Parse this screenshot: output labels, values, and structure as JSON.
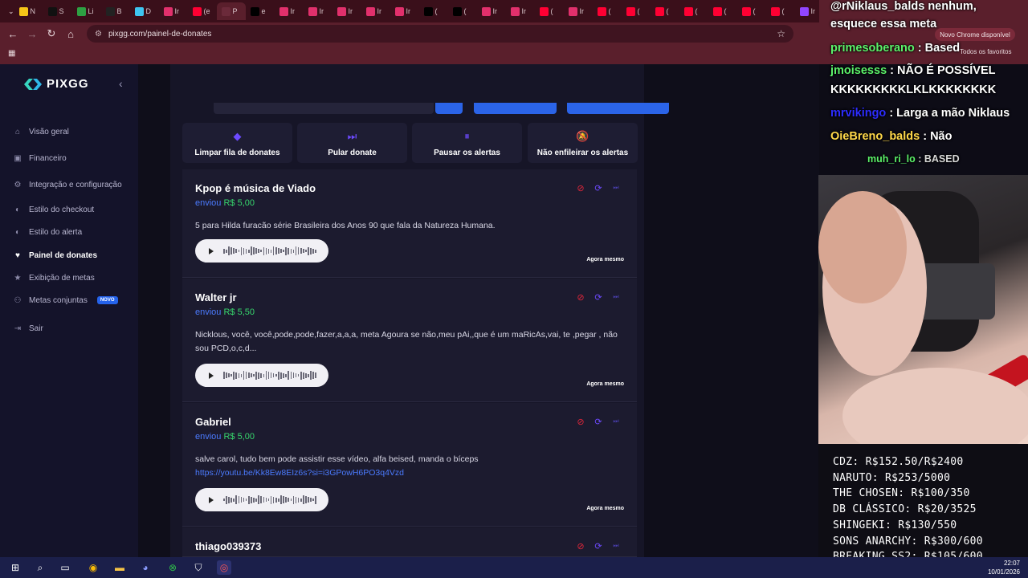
{
  "browser": {
    "url": "pixgg.com/painel-de-donates",
    "update_notice": "Novo Chrome disponível",
    "all_favorites": "Todos os favoritos",
    "tabs": [
      {
        "label": "N",
        "color": "#f5c518"
      },
      {
        "label": "S",
        "color": "#111111"
      },
      {
        "label": "Li",
        "color": "#2ea043"
      },
      {
        "label": "B",
        "color": "#222222"
      },
      {
        "label": "D",
        "color": "#3ec5f0"
      },
      {
        "label": "Ir",
        "color": "#e1306c"
      },
      {
        "label": "(e",
        "color": "#ff0033"
      },
      {
        "label": "P",
        "color": "#6b2a3a"
      },
      {
        "label": "e",
        "color": "#000000"
      },
      {
        "label": "Ir",
        "color": "#e1306c"
      },
      {
        "label": "Ir",
        "color": "#e1306c"
      },
      {
        "label": "Ir",
        "color": "#e1306c"
      },
      {
        "label": "Ir",
        "color": "#e1306c"
      },
      {
        "label": "Ir",
        "color": "#e1306c"
      },
      {
        "label": "(",
        "color": "#000000"
      },
      {
        "label": "(",
        "color": "#000000"
      },
      {
        "label": "Ir",
        "color": "#e1306c"
      },
      {
        "label": "Ir",
        "color": "#e1306c"
      },
      {
        "label": "(",
        "color": "#ff0033"
      },
      {
        "label": "Ir",
        "color": "#e1306c"
      },
      {
        "label": "(",
        "color": "#ff0033"
      },
      {
        "label": "(",
        "color": "#ff0033"
      },
      {
        "label": "(",
        "color": "#ff0033"
      },
      {
        "label": "(",
        "color": "#ff0033"
      },
      {
        "label": "(",
        "color": "#ff0033"
      },
      {
        "label": "(",
        "color": "#ff0033"
      },
      {
        "label": "(",
        "color": "#ff0033"
      },
      {
        "label": "Ir",
        "color": "#9146ff"
      }
    ]
  },
  "app": {
    "brand": "PIXGG",
    "nav": [
      {
        "label": "Visão geral",
        "icon": "home-icon"
      },
      {
        "label": "Financeiro",
        "icon": "wallet-icon"
      },
      {
        "label": "Integração e configuração",
        "icon": "settings-icon"
      },
      {
        "label": "Estilo do checkout",
        "icon": "palette-icon"
      },
      {
        "label": "Estilo do alerta",
        "icon": "palette-icon"
      },
      {
        "label": "Painel de donates",
        "icon": "donate-icon",
        "active": true
      },
      {
        "label": "Exibição de metas",
        "icon": "star-icon"
      },
      {
        "label": "Metas conjuntas",
        "icon": "users-icon",
        "badge": "NOVO"
      },
      {
        "label": "Sair",
        "icon": "logout-icon"
      }
    ],
    "actions": [
      {
        "label": "Limpar fila de donates",
        "icon": "eraser-icon"
      },
      {
        "label": "Pular donate",
        "icon": "skip-icon"
      },
      {
        "label": "Pausar os alertas",
        "icon": "pause-icon"
      },
      {
        "label": "Não enfileirar os alertas",
        "icon": "bell-off-icon"
      }
    ],
    "donates": [
      {
        "name": "Kpop é música de Viado",
        "sent": "enviou",
        "value": "R$ 5,00",
        "message": "5 para Hilda furacão série Brasileira dos Anos 90 que fala da Natureza Humana.",
        "time": "Agora mesmo"
      },
      {
        "name": "Walter jr",
        "sent": "enviou",
        "value": "R$ 5,50",
        "message": "Nicklous, você, você,pode,pode,fazer,a,a,a, meta Agoura se não,meu pAi,,que é um maRicAs,vai, te ,pegar , não sou PCD,o,c,d...",
        "time": "Agora mesmo"
      },
      {
        "name": "Gabriel",
        "sent": "enviou",
        "value": "R$ 5,00",
        "message": "salve carol, tudo bem pode assistir esse vídeo, alfa beised, manda o bíceps",
        "link": "https://youtu.be/Kk8Ew8EIz6s?si=i3GPowH6PO3q4Vzd",
        "time": "Agora mesmo"
      },
      {
        "name": "thiago039373"
      }
    ]
  },
  "chat": [
    {
      "user": "@rNiklaus_balds",
      "text": " nenhum,"
    },
    {
      "user": "",
      "text": "esquece essa meta"
    },
    {
      "user": "primesoberano",
      "text": " : Based",
      "user_color": "#5cf26a"
    },
    {
      "user": "jmoisesss",
      "text": " : NÃO É POSSÍVEL",
      "user_color": "#5cf26a"
    },
    {
      "user": "",
      "text": "KKKKKKKKKLKLKKKKKKKK"
    },
    {
      "user": "mrvikingo",
      "text": " : Larga a mão Niklaus",
      "user_color": "#2d2dff"
    },
    {
      "user": "OieBreno_balds",
      "text": " : Não",
      "user_color": "#ffd84a"
    },
    {
      "user": "muh_ri_lo",
      "text": " : BASED",
      "user_color": "#5cf26a"
    }
  ],
  "goals": [
    "CDZ: R$152.50/R$2400",
    "NARUTO: R$253/5000",
    "THE CHOSEN: R$100/350",
    "DB CLÁSSICO: R$20/3525",
    "SHINGEKI: R$130/550",
    "SONS ANARCHY: R$300/600",
    "BREAKING SS2: R$105/600"
  ],
  "taskbar": {
    "time": "22:07",
    "date": "10/01/2026"
  }
}
